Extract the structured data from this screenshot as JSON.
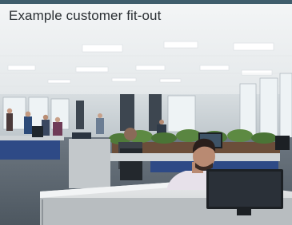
{
  "caption": {
    "text": "Example customer fit-out"
  },
  "colors": {
    "accent_rule": "#3f5d6c",
    "ceiling": "#eef1f2",
    "floor": "#5a6570",
    "desk": "#d9dcdd",
    "plants": "#4f7a3a",
    "monitor": "#1c2024"
  },
  "scene": {
    "subject": "open-plan office interior",
    "foreground_icon": "person-at-computer-icon"
  }
}
